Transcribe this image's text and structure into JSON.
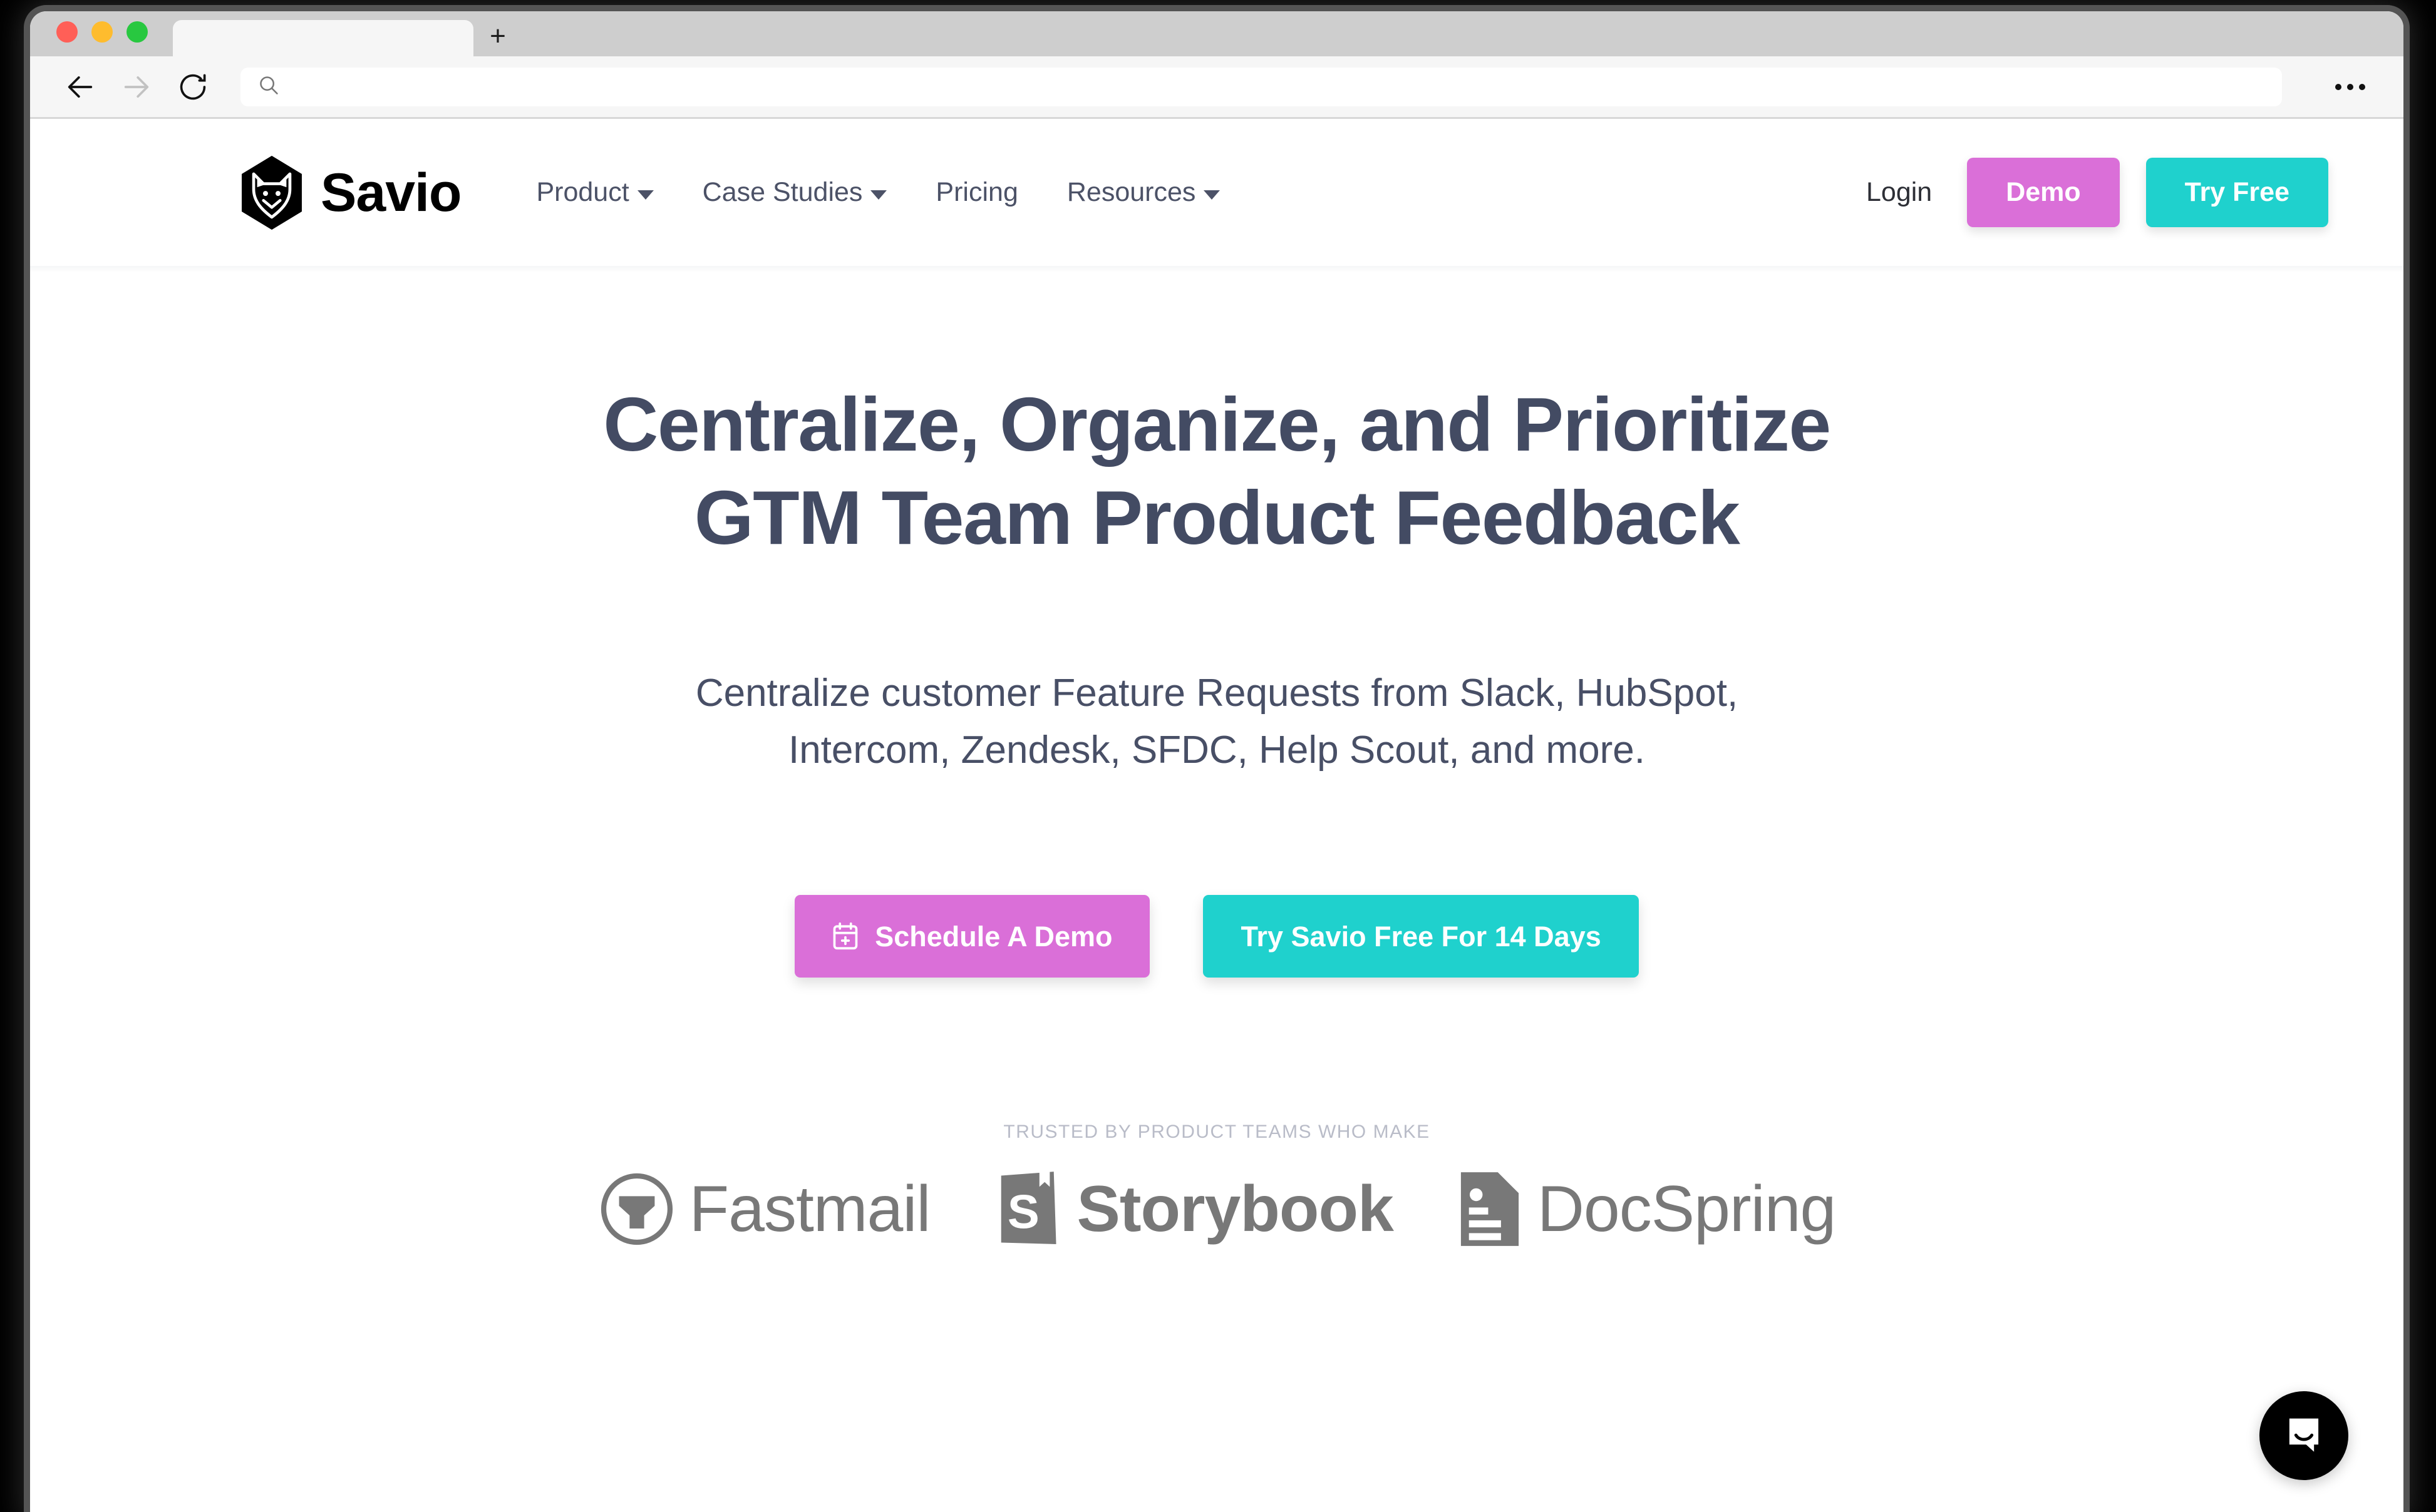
{
  "browser": {
    "traffic_lights": [
      "close",
      "minimize",
      "maximize"
    ],
    "tab_title": "",
    "new_tab_label": "+",
    "url_value": "",
    "url_placeholder": "",
    "menu_label": "...",
    "back_icon": "back-arrow-icon",
    "forward_icon": "forward-arrow-icon",
    "reload_icon": "reload-icon",
    "search_icon": "search-icon"
  },
  "header": {
    "brand_name": "Savio",
    "brand_icon": "fox-head-logo-icon",
    "nav": [
      {
        "label": "Product",
        "has_caret": true
      },
      {
        "label": "Case Studies",
        "has_caret": true
      },
      {
        "label": "Pricing",
        "has_caret": false
      },
      {
        "label": "Resources",
        "has_caret": true
      }
    ],
    "login_label": "Login",
    "demo_label": "Demo",
    "try_free_label": "Try Free"
  },
  "hero": {
    "title_line1": "Centralize, Organize, and Prioritize",
    "title_line2": "GTM Team Product Feedback",
    "subtitle_line1": "Centralize customer Feature Requests from Slack, HubSpot,",
    "subtitle_line2": "Intercom, Zendesk, SFDC, Help Scout, and more.",
    "cta_primary_label": "Schedule A Demo",
    "cta_primary_icon": "calendar-icon",
    "cta_secondary_label": "Try Savio Free For 14 Days"
  },
  "trusted": {
    "label": "TRUSTED BY PRODUCT TEAMS WHO MAKE",
    "logos": [
      {
        "name": "Fastmail",
        "icon": "fastmail-envelope-icon"
      },
      {
        "name": "Storybook",
        "icon": "storybook-book-icon"
      },
      {
        "name": "DocSpring",
        "icon": "docspring-document-icon"
      }
    ]
  },
  "widget": {
    "intercom_icon": "chat-bubble-icon"
  },
  "colors": {
    "accent_magenta": "#da6fd8",
    "accent_teal": "#1fd1cd",
    "heading_slate": "#434b63",
    "nav_text": "#4c5267",
    "muted_gray": "#b9bcc8",
    "logo_gray": "#787878"
  }
}
